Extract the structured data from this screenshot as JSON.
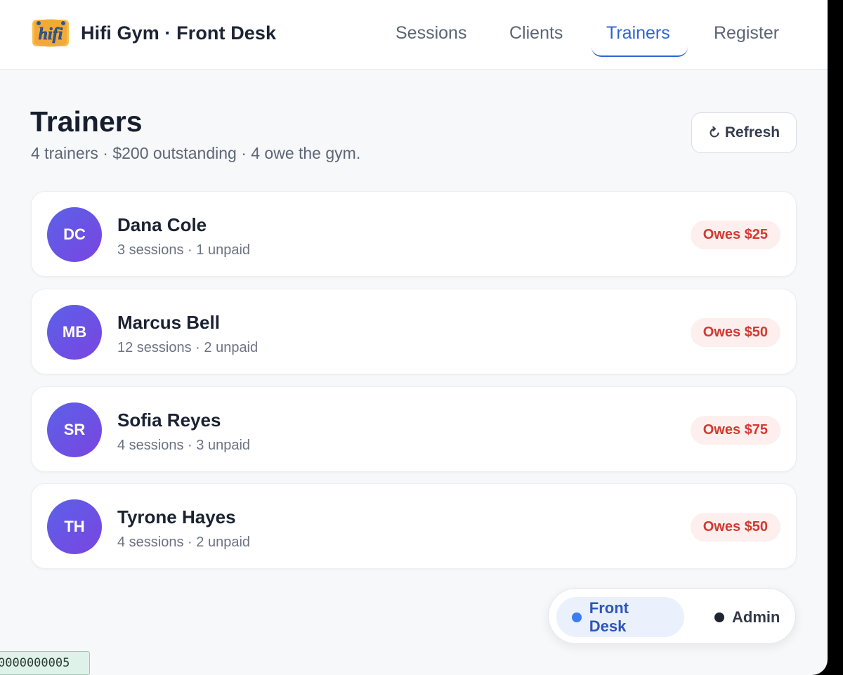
{
  "app": {
    "title": "Hifi Gym · Front Desk",
    "logo_text": "hifi",
    "accent_color": "#2f63d6"
  },
  "nav": {
    "tabs": [
      {
        "label": "Sessions",
        "active": false
      },
      {
        "label": "Clients",
        "active": false
      },
      {
        "label": "Trainers",
        "active": true
      },
      {
        "label": "Register",
        "active": false
      }
    ]
  },
  "page": {
    "title": "Trainers",
    "subtitle": "4 trainers · $200 outstanding · 4 owe the gym.",
    "refresh_label": "Refresh",
    "refresh_icon": "refresh-icon"
  },
  "trainers": [
    {
      "initials": "DC",
      "name": "Dana Cole",
      "meta": "3 sessions · 1 unpaid",
      "balance": "Owes $25"
    },
    {
      "initials": "MB",
      "name": "Marcus Bell",
      "meta": "12 sessions · 2 unpaid",
      "balance": "Owes $50"
    },
    {
      "initials": "SR",
      "name": "Sofia Reyes",
      "meta": "4 sessions · 3 unpaid",
      "balance": "Owes $75"
    },
    {
      "initials": "TH",
      "name": "Tyrone Hayes",
      "meta": "4 sessions · 2 unpaid",
      "balance": "Owes $50"
    }
  ],
  "role_switch": {
    "options": [
      {
        "label": "Front Desk",
        "active": true,
        "dot_color": "#3b7ef0"
      },
      {
        "label": "Admin",
        "active": false,
        "dot_color": "#1e2430"
      }
    ]
  },
  "debug": {
    "tag": "0000000005"
  },
  "colors": {
    "owes_text": "#d23a31",
    "owes_bg": "#fcefee",
    "avatar_gradient_start": "#5b61e8",
    "avatar_gradient_end": "#7a45e0"
  }
}
